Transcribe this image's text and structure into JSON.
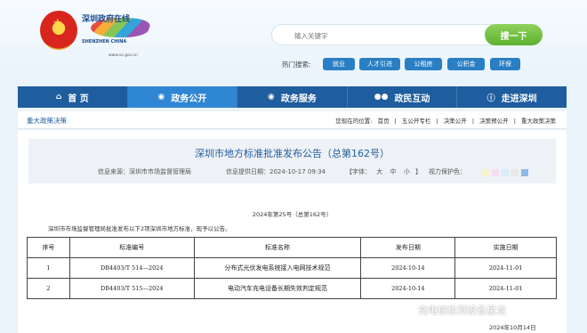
{
  "header": {
    "logo": {
      "title": "深圳政府在线",
      "en": "SHENZHEN CHINA",
      "url": "www.sz.gov.cn"
    },
    "search": {
      "placeholder": "输入关键字",
      "button_label": "搜一下"
    },
    "hot_label": "热门搜索:",
    "hot_tags": [
      "就业",
      "人才引进",
      "公租房",
      "公积金",
      "环保"
    ]
  },
  "nav": {
    "items": [
      {
        "label": "首 页",
        "icon": "home-icon"
      },
      {
        "label": "政务公开",
        "icon": "eye-icon",
        "active": true
      },
      {
        "label": "政务服务",
        "icon": "service-icon"
      },
      {
        "label": "政民互动",
        "icon": "people-icon"
      },
      {
        "label": "走进深圳",
        "icon": "info-icon"
      }
    ]
  },
  "crumb": {
    "section": "重大政策决策",
    "prefix": "您现在的位置:",
    "items": [
      "首页",
      "五公开专栏",
      "决策公开",
      "决策预公开",
      "重大政策决策"
    ]
  },
  "article": {
    "title": "深圳市地方标准批准发布公告（总第162号）",
    "source": "信息来源：深圳市市场监督管理局",
    "date": "信息提供日期：2024-10-17 09:34",
    "font_label": "【字体：",
    "font_sizes": [
      "大",
      "中",
      "小"
    ],
    "font_close": "】",
    "vision_label": "视力保护色：",
    "vision_colors": [
      "#f6f3cf",
      "#f4dff0",
      "#d6eef9",
      "#e8e8e8",
      "#8fb8ea"
    ],
    "issue": "2024年第25号（总第162号）",
    "intro": "深圳市市场监督管理局批准发布以下2项深圳市地方标准，现予以公告。",
    "table": {
      "headers": [
        "序号",
        "标准编号",
        "标准名称",
        "发布日期",
        "实施日期"
      ],
      "rows": [
        [
          "1",
          "DB4403/T 514—2024",
          "分布式光伏发电系统接入电网技术规范",
          "2024-10-14",
          "2024-11-01"
        ],
        [
          "2",
          "DB4403/T 515—2024",
          "电动汽车充电设备长期失效判定规范",
          "2024-10-14",
          "2024-11-01"
        ]
      ]
    },
    "footer_date": "2024年10月14日"
  },
  "watermark": "充电桩检测设备星龙"
}
